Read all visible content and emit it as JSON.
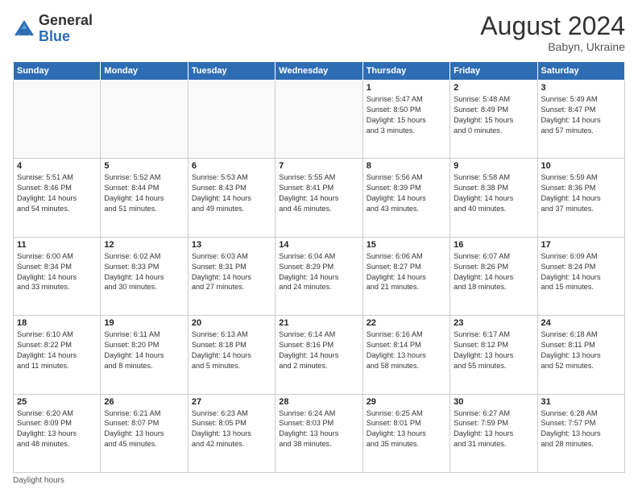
{
  "logo": {
    "general": "General",
    "blue": "Blue"
  },
  "title": {
    "month_year": "August 2024",
    "location": "Babyn, Ukraine"
  },
  "days_of_week": [
    "Sunday",
    "Monday",
    "Tuesday",
    "Wednesday",
    "Thursday",
    "Friday",
    "Saturday"
  ],
  "footer": {
    "daylight_hours": "Daylight hours"
  },
  "weeks": [
    [
      {
        "day": "",
        "info": ""
      },
      {
        "day": "",
        "info": ""
      },
      {
        "day": "",
        "info": ""
      },
      {
        "day": "",
        "info": ""
      },
      {
        "day": "1",
        "info": "Sunrise: 5:47 AM\nSunset: 8:50 PM\nDaylight: 15 hours\nand 3 minutes."
      },
      {
        "day": "2",
        "info": "Sunrise: 5:48 AM\nSunset: 8:49 PM\nDaylight: 15 hours\nand 0 minutes."
      },
      {
        "day": "3",
        "info": "Sunrise: 5:49 AM\nSunset: 8:47 PM\nDaylight: 14 hours\nand 57 minutes."
      }
    ],
    [
      {
        "day": "4",
        "info": "Sunrise: 5:51 AM\nSunset: 8:46 PM\nDaylight: 14 hours\nand 54 minutes."
      },
      {
        "day": "5",
        "info": "Sunrise: 5:52 AM\nSunset: 8:44 PM\nDaylight: 14 hours\nand 51 minutes."
      },
      {
        "day": "6",
        "info": "Sunrise: 5:53 AM\nSunset: 8:43 PM\nDaylight: 14 hours\nand 49 minutes."
      },
      {
        "day": "7",
        "info": "Sunrise: 5:55 AM\nSunset: 8:41 PM\nDaylight: 14 hours\nand 46 minutes."
      },
      {
        "day": "8",
        "info": "Sunrise: 5:56 AM\nSunset: 8:39 PM\nDaylight: 14 hours\nand 43 minutes."
      },
      {
        "day": "9",
        "info": "Sunrise: 5:58 AM\nSunset: 8:38 PM\nDaylight: 14 hours\nand 40 minutes."
      },
      {
        "day": "10",
        "info": "Sunrise: 5:59 AM\nSunset: 8:36 PM\nDaylight: 14 hours\nand 37 minutes."
      }
    ],
    [
      {
        "day": "11",
        "info": "Sunrise: 6:00 AM\nSunset: 8:34 PM\nDaylight: 14 hours\nand 33 minutes."
      },
      {
        "day": "12",
        "info": "Sunrise: 6:02 AM\nSunset: 8:33 PM\nDaylight: 14 hours\nand 30 minutes."
      },
      {
        "day": "13",
        "info": "Sunrise: 6:03 AM\nSunset: 8:31 PM\nDaylight: 14 hours\nand 27 minutes."
      },
      {
        "day": "14",
        "info": "Sunrise: 6:04 AM\nSunset: 8:29 PM\nDaylight: 14 hours\nand 24 minutes."
      },
      {
        "day": "15",
        "info": "Sunrise: 6:06 AM\nSunset: 8:27 PM\nDaylight: 14 hours\nand 21 minutes."
      },
      {
        "day": "16",
        "info": "Sunrise: 6:07 AM\nSunset: 8:26 PM\nDaylight: 14 hours\nand 18 minutes."
      },
      {
        "day": "17",
        "info": "Sunrise: 6:09 AM\nSunset: 8:24 PM\nDaylight: 14 hours\nand 15 minutes."
      }
    ],
    [
      {
        "day": "18",
        "info": "Sunrise: 6:10 AM\nSunset: 8:22 PM\nDaylight: 14 hours\nand 11 minutes."
      },
      {
        "day": "19",
        "info": "Sunrise: 6:11 AM\nSunset: 8:20 PM\nDaylight: 14 hours\nand 8 minutes."
      },
      {
        "day": "20",
        "info": "Sunrise: 6:13 AM\nSunset: 8:18 PM\nDaylight: 14 hours\nand 5 minutes."
      },
      {
        "day": "21",
        "info": "Sunrise: 6:14 AM\nSunset: 8:16 PM\nDaylight: 14 hours\nand 2 minutes."
      },
      {
        "day": "22",
        "info": "Sunrise: 6:16 AM\nSunset: 8:14 PM\nDaylight: 13 hours\nand 58 minutes."
      },
      {
        "day": "23",
        "info": "Sunrise: 6:17 AM\nSunset: 8:12 PM\nDaylight: 13 hours\nand 55 minutes."
      },
      {
        "day": "24",
        "info": "Sunrise: 6:18 AM\nSunset: 8:11 PM\nDaylight: 13 hours\nand 52 minutes."
      }
    ],
    [
      {
        "day": "25",
        "info": "Sunrise: 6:20 AM\nSunset: 8:09 PM\nDaylight: 13 hours\nand 48 minutes."
      },
      {
        "day": "26",
        "info": "Sunrise: 6:21 AM\nSunset: 8:07 PM\nDaylight: 13 hours\nand 45 minutes."
      },
      {
        "day": "27",
        "info": "Sunrise: 6:23 AM\nSunset: 8:05 PM\nDaylight: 13 hours\nand 42 minutes."
      },
      {
        "day": "28",
        "info": "Sunrise: 6:24 AM\nSunset: 8:03 PM\nDaylight: 13 hours\nand 38 minutes."
      },
      {
        "day": "29",
        "info": "Sunrise: 6:25 AM\nSunset: 8:01 PM\nDaylight: 13 hours\nand 35 minutes."
      },
      {
        "day": "30",
        "info": "Sunrise: 6:27 AM\nSunset: 7:59 PM\nDaylight: 13 hours\nand 31 minutes."
      },
      {
        "day": "31",
        "info": "Sunrise: 6:28 AM\nSunset: 7:57 PM\nDaylight: 13 hours\nand 28 minutes."
      }
    ]
  ]
}
